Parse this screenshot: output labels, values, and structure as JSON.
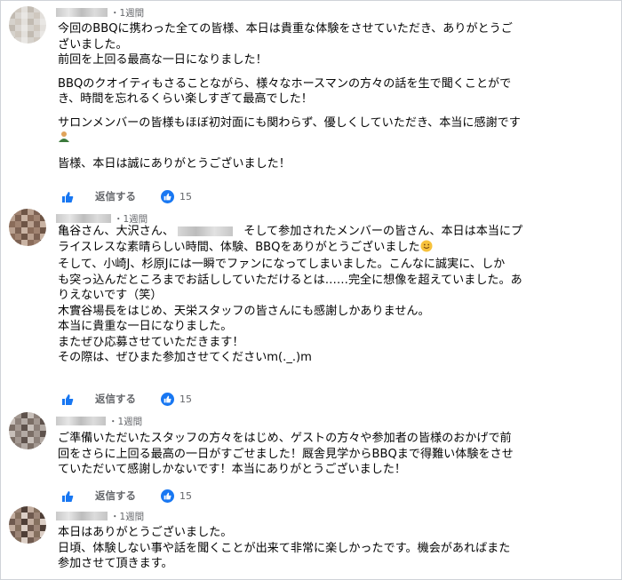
{
  "comments": [
    {
      "time": "・1週間",
      "lines": [
        "今回のBBQに携わった全ての皆様、本日は貴重な体験をさせていただき、ありがとうご",
        "ざいました。",
        "前回を上回る最高な一日になりました！",
        "",
        "BBQのクオイティもさることながら、様々なホースマンの方々の話を生で聞くことがで",
        "き、時間を忘れるくらい楽しすぎて最高でした！",
        "",
        "サロンメンバーの皆様もほぼ初対面にも関わらず、優しくしていただき、本当に感謝です",
        "",
        "皆様、本日は誠にありがとうございました！"
      ],
      "reply_label": "返信する",
      "reaction_count": "15",
      "avatar_palette": [
        "#d6d2cc",
        "#cfc8bf",
        "#e3e0dc",
        "#c2bbb2",
        "#dad6d1",
        "#e9e7e4"
      ]
    },
    {
      "time": "・1週間",
      "line1_a": "亀谷さん、大沢さん、",
      "line1_b": "  そして参加されたメンバーの皆さん、本日は本当にプ",
      "lines": [
        "ライスレスな素晴らしい時間、体験、BBQをありがとうございました",
        "そして、小崎J、杉原Jには一瞬でファンになってしまいました。こんなに誠実に、しか",
        "も突っ込んだところまでお話ししていただけるとは……完全に想像を超えていました。あ",
        "りえないです（笑）",
        "木實谷場長をはじめ、天栄スタッフの皆さんにも感謝しかありません。",
        "本当に貴重な一日になりました。",
        "またぜひ応募させていただきます！",
        "その際は、ぜひまた参加させてくださいm(._.)m"
      ],
      "reply_label": "返信する",
      "reaction_count": "15",
      "avatar_palette": [
        "#8a6c5a",
        "#a08371",
        "#6e5546",
        "#b9a08f",
        "#7d6253",
        "#c9b3a3"
      ]
    },
    {
      "time": "・1週間",
      "lines": [
        "ご準備いただいたスタッフの方々をはじめ、ゲストの方々や参加者の皆様のおかげで前",
        "回をさらに上回る最高の一日がすごせました！厩舎見学からBBQまで得難い体験をさせ",
        "ていただいて感謝しかないです！本当にありがとうございました！"
      ],
      "reply_label": "返信する",
      "reaction_count": "15",
      "avatar_palette": [
        "#7b6e66",
        "#a39891",
        "#5e524c",
        "#c7bfb9",
        "#8c8079",
        "#b3aaa4"
      ]
    },
    {
      "time": "・1週間",
      "lines": [
        "本日はありがとうございました。",
        "日頃、体験しない事や話を聞くことが出来て非常に楽しかったです。機会があればまた",
        "参加させて頂きます。"
      ],
      "avatar_palette": [
        "#6f5a4f",
        "#9c8577",
        "#4f3f37",
        "#c2ad9f",
        "#85705f",
        "#dccfc6"
      ]
    }
  ],
  "colors": {
    "like_blue": "#1877f2",
    "meta_gray": "#65676b"
  },
  "icons": {
    "like": "thumbs-up-icon",
    "reaction": "like-reaction-icon"
  }
}
